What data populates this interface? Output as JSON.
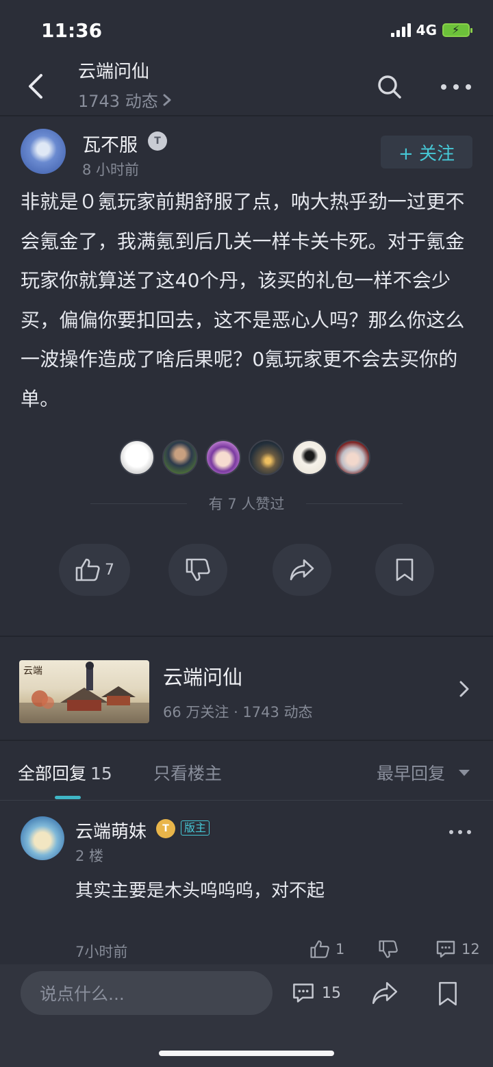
{
  "status": {
    "time": "11:36",
    "network": "4G"
  },
  "header": {
    "title": "云端问仙",
    "subtitle": "1743 动态"
  },
  "post": {
    "author": "瓦不服",
    "author_level": "T",
    "time": "8 小时前",
    "follow_label": "+ 关注",
    "body": "非就是０氪玩家前期舒服了点，呐大热乎劲一过更不会氪金了，我满氪到后几关一样卡关卡死。对于氪金玩家你就算送了这40个丹，该买的礼包一样不会少买，偏偏你要扣回去，这不是恶心人吗？那么你这么一波操作造成了啥后果呢？0氪玩家更不会去买你的单。",
    "likes_summary": "有 7 人赞过",
    "like_count": "7",
    "liker_avatars": [
      "liker-1",
      "liker-2",
      "liker-3",
      "liker-4",
      "liker-5",
      "liker-6"
    ]
  },
  "forum_card": {
    "name": "云端问仙",
    "stats": "66 万关注 · 1743 动态"
  },
  "replies_tabs": {
    "all_label": "全部回复",
    "all_count": "15",
    "owner_only_label": "只看楼主",
    "sort_label": "最早回复"
  },
  "reply": {
    "author": "云端萌妹",
    "author_level": "T",
    "badge": "版主",
    "floor": "2 楼",
    "text": "其实主要是木头呜呜呜，对不起",
    "time": "7小时前",
    "like_count": "1",
    "comment_count": "12"
  },
  "bottom_bar": {
    "input_placeholder": "说点什么...",
    "comment_count": "15"
  },
  "colors": {
    "background": "#2b2e38",
    "accent": "#46c8d6",
    "text_primary": "#e6e8ee",
    "text_secondary": "#858a96"
  }
}
